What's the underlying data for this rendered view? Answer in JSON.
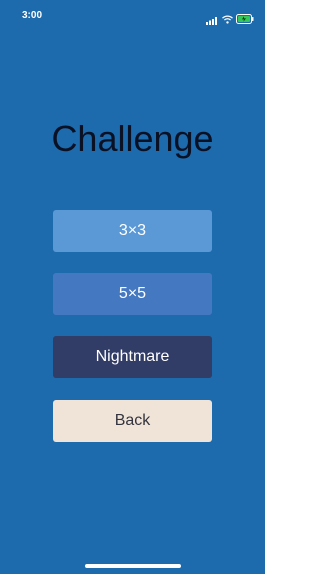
{
  "status_bar": {
    "time": "3:00",
    "icons": [
      "signal-icon",
      "wifi-icon",
      "battery-icon"
    ]
  },
  "title": "Challenge",
  "buttons": {
    "three": "3×3",
    "five": "5×5",
    "nightmare": "Nightmare",
    "back": "Back"
  },
  "colors": {
    "background": "#1d6aad",
    "button_3x3": "#5b98d6",
    "button_5x5": "#4479c1",
    "button_nightmare": "#313c67",
    "button_back": "#f0e4d9",
    "title_text": "#0a1124"
  }
}
